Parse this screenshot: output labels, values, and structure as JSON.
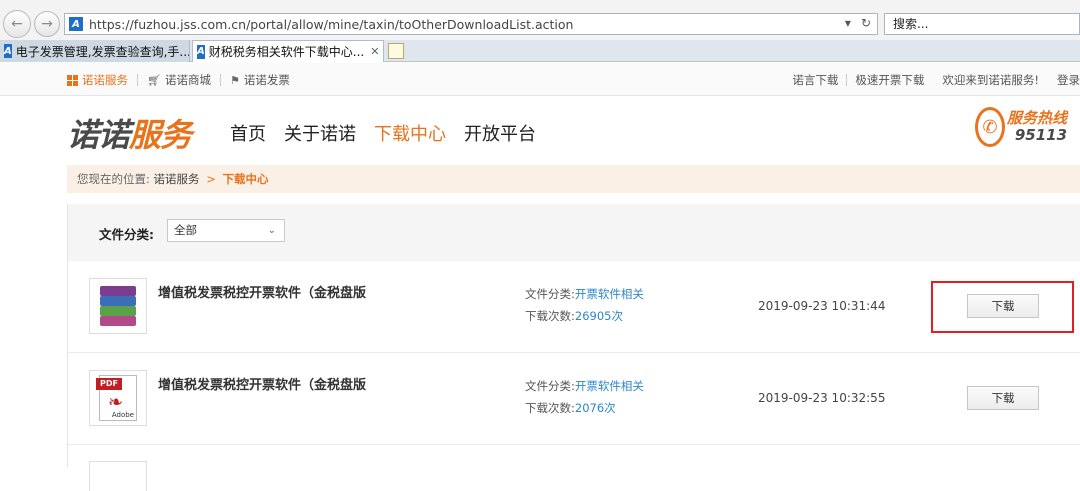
{
  "browser": {
    "url": "https://fuzhou.jss.com.cn/portal/allow/mine/taxin/toOtherDownloadList.action",
    "search_placeholder": "搜索...",
    "tabs": [
      {
        "label": "电子发票管理,发票查验查询,手..."
      },
      {
        "label": "财税税务相关软件下载中心..."
      }
    ]
  },
  "topbar": {
    "left": [
      "诺诺服务",
      "诺诺商城",
      "诺诺发票"
    ],
    "right": [
      "诺言下载",
      "极速开票下载",
      "欢迎来到诺诺服务!",
      "登录"
    ]
  },
  "header": {
    "logo_part1": "诺诺",
    "logo_part2": "服务",
    "nav": [
      "首页",
      "关于诺诺",
      "下载中心",
      "开放平台"
    ],
    "active_nav": "下载中心",
    "hotline_title": "服务热线",
    "hotline_number": "95113"
  },
  "breadcrumb": {
    "prefix": "您现在的位置:",
    "home": "诺诺服务",
    "separator": ">",
    "current": "下载中心"
  },
  "filter": {
    "label": "文件分类:",
    "selected": "全部"
  },
  "files": [
    {
      "title": "增值税发票税控开票软件（金税盘版",
      "category_label": "文件分类:",
      "category": "开票软件相关",
      "downloads_label": "下载次数:",
      "downloads": "26905次",
      "date": "2019-09-23 10:31:44",
      "button": "下载",
      "icon": "rar-archive-icon"
    },
    {
      "title": "增值税发票税控开票软件（金税盘版",
      "category_label": "文件分类:",
      "category": "开票软件相关",
      "downloads_label": "下载次数:",
      "downloads": "2076次",
      "date": "2019-09-23 10:32:55",
      "button": "下载",
      "icon": "pdf-file-icon"
    }
  ],
  "colors": {
    "brand_orange": "#e8731d",
    "link_blue": "#2d86c8",
    "highlight_red": "#e02020"
  }
}
